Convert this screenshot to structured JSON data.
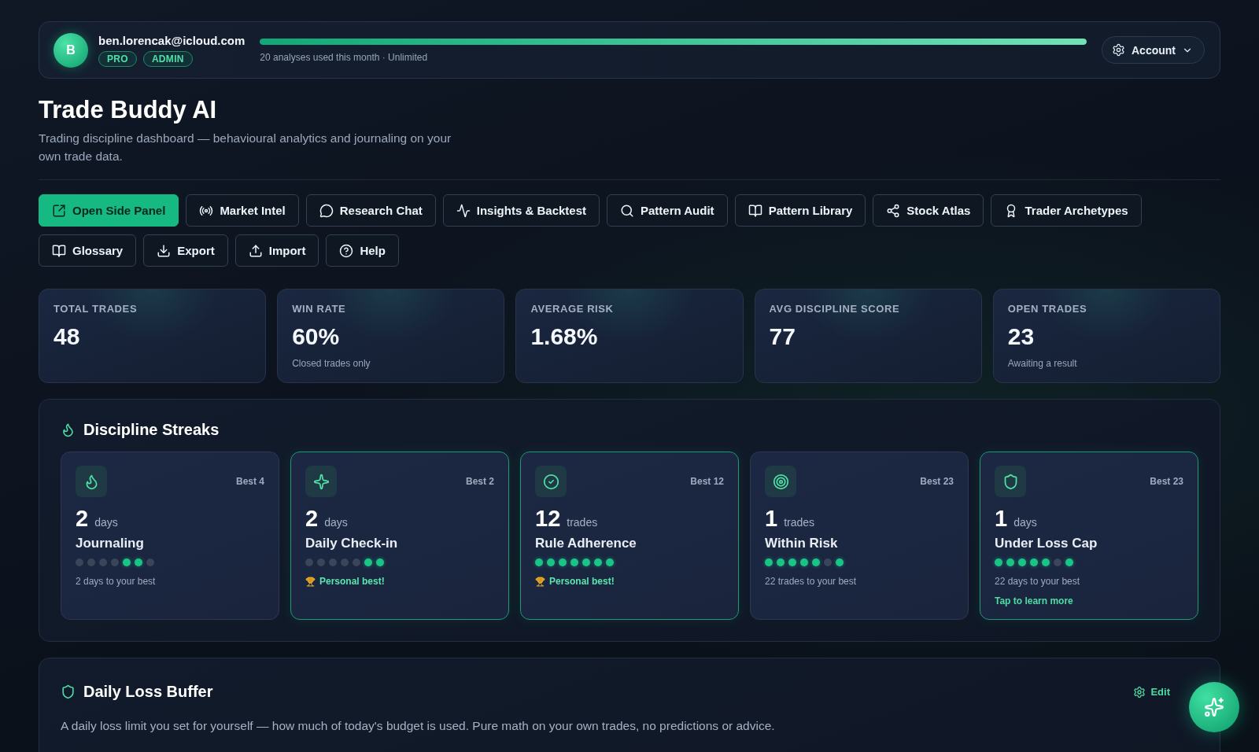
{
  "account_bar": {
    "avatar_initial": "B",
    "email": "ben.lorencak@icloud.com",
    "badges": [
      "PRO",
      "ADMIN"
    ],
    "usage": {
      "level": 1,
      "caption": "20 analyses used this month · Unlimited"
    },
    "account_button": {
      "label": "Account"
    }
  },
  "header": {
    "title": "Trade Buddy AI",
    "subtitle": "Trading discipline dashboard — behavioural analytics and journaling on your own trade data."
  },
  "nav_buttons": [
    {
      "label": "Open Side Panel",
      "kind": "external",
      "primary": true
    },
    {
      "label": "Market Intel",
      "kind": "broadcast",
      "primary": false
    },
    {
      "label": "Research Chat",
      "kind": "chat",
      "primary": false
    },
    {
      "label": "Insights & Backtest",
      "kind": "pulse",
      "primary": false
    },
    {
      "label": "Pattern Audit",
      "kind": "search",
      "primary": false
    },
    {
      "label": "Pattern Library",
      "kind": "book",
      "primary": false
    },
    {
      "label": "Stock Atlas",
      "kind": "share",
      "primary": false
    },
    {
      "label": "Trader Archetypes",
      "kind": "award",
      "primary": false
    },
    {
      "label": "Glossary",
      "kind": "book",
      "primary": false
    },
    {
      "label": "Export",
      "kind": "download",
      "primary": false
    },
    {
      "label": "Import",
      "kind": "upload",
      "primary": false
    },
    {
      "label": "Help",
      "kind": "help",
      "primary": false
    }
  ],
  "stats": [
    {
      "label": "TOTAL TRADES",
      "value": "48"
    },
    {
      "label": "WIN RATE",
      "value": "60%",
      "note": "Closed trades only"
    },
    {
      "label": "AVERAGE RISK",
      "value": "1.68%"
    },
    {
      "label": "AVG DISCIPLINE SCORE",
      "value": "77"
    },
    {
      "label": "OPEN TRADES",
      "value": "23",
      "note": "Awaiting a result"
    }
  ],
  "streaks": {
    "title": "Discipline Streaks",
    "cards": [
      {
        "kind": "journaling",
        "best": "Best 4",
        "value": "2",
        "unit": "days",
        "title": "Journaling",
        "highlighted": false,
        "dots": [
          {
            "filled": false
          },
          {
            "filled": false
          },
          {
            "filled": false
          },
          {
            "filled": false
          },
          {
            "filled": true
          },
          {
            "filled": true
          },
          {
            "filled": false
          }
        ],
        "footer": {
          "kind": "progress",
          "text": "2 days to your best"
        }
      },
      {
        "kind": "checkin",
        "best": "Best 2",
        "value": "2",
        "unit": "days",
        "title": "Daily Check-in",
        "highlighted": true,
        "dots": [
          {
            "filled": false
          },
          {
            "filled": false
          },
          {
            "filled": false
          },
          {
            "filled": false
          },
          {
            "filled": false
          },
          {
            "filled": true
          },
          {
            "filled": true
          }
        ],
        "footer": {
          "kind": "personal_best",
          "text": "Personal best!"
        }
      },
      {
        "kind": "rules",
        "best": "Best 12",
        "value": "12",
        "unit": "trades",
        "title": "Rule Adherence",
        "highlighted": true,
        "dots": [
          {
            "filled": true
          },
          {
            "filled": true
          },
          {
            "filled": true
          },
          {
            "filled": true
          },
          {
            "filled": true
          },
          {
            "filled": true
          },
          {
            "filled": true
          }
        ],
        "footer": {
          "kind": "personal_best",
          "text": "Personal best!"
        }
      },
      {
        "kind": "risk",
        "best": "Best 23",
        "value": "1",
        "unit": "trades",
        "title": "Within Risk",
        "highlighted": false,
        "dots": [
          {
            "filled": true
          },
          {
            "filled": true
          },
          {
            "filled": true
          },
          {
            "filled": true
          },
          {
            "filled": true
          },
          {
            "filled": false
          },
          {
            "filled": true
          }
        ],
        "footer": {
          "kind": "progress",
          "text": "22 trades to your best"
        }
      },
      {
        "kind": "losscap",
        "best": "Best 23",
        "value": "1",
        "unit": "days",
        "title": "Under Loss Cap",
        "highlighted": true,
        "dots": [
          {
            "filled": true
          },
          {
            "filled": true
          },
          {
            "filled": true
          },
          {
            "filled": true
          },
          {
            "filled": true
          },
          {
            "filled": false
          },
          {
            "filled": true
          }
        ],
        "footer": {
          "kind": "progress",
          "text": "22 days to your best"
        },
        "link": "Tap to learn more"
      }
    ]
  },
  "loss_buffer": {
    "title": "Daily Loss Buffer",
    "edit_label": "Edit",
    "description": "A daily loss limit you set for yourself — how much of today's budget is used. Pure math on your own trades, no predictions or advice."
  }
}
